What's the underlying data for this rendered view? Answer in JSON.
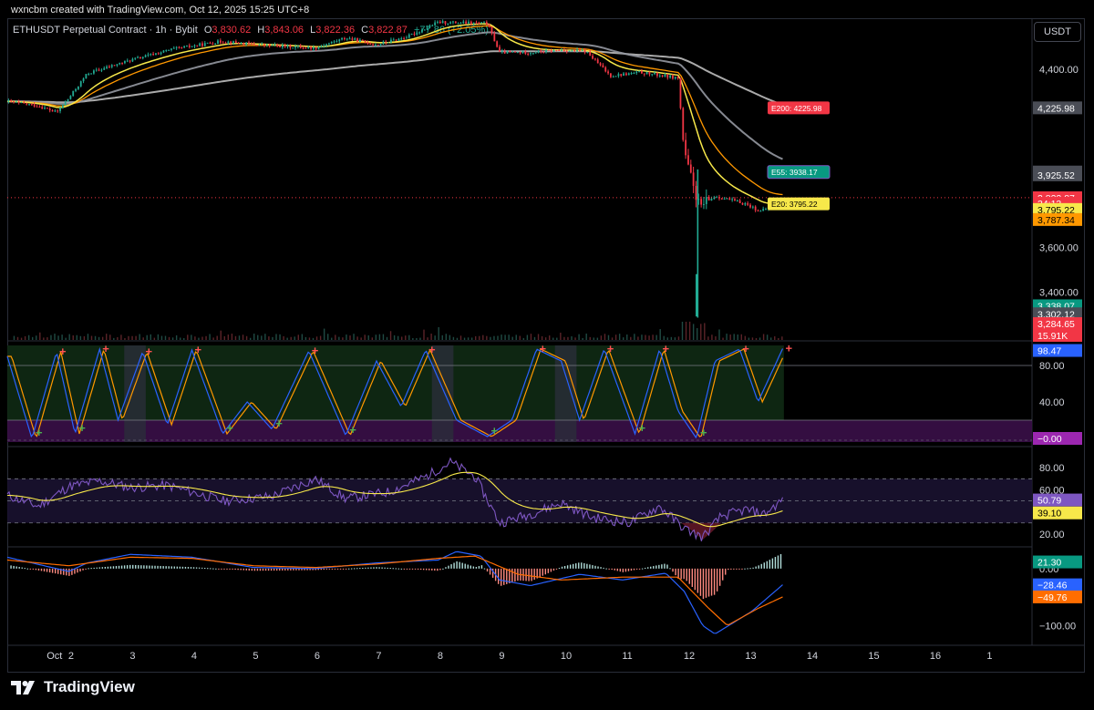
{
  "header": {
    "creator": "wxncbm created with TradingView.com, Oct 12, 2025 15:25 UTC+8"
  },
  "symbol": {
    "title": "ETHUSDT Perpetual Contract · 1h · Bybit",
    "o_label": "O",
    "o": "3,830.62",
    "h_label": "H",
    "h": "3,843.06",
    "l_label": "L",
    "l": "3,822.36",
    "c_label": "C",
    "c": "3,822.87",
    "change": "+77.86 (+2.05%)"
  },
  "currency_button": "USDT",
  "brand": {
    "name": "TradingView",
    "icon": "tradingview-logo-icon"
  },
  "colors": {
    "up": "#22ab94",
    "down": "#f23645",
    "ema20": "#f7e84a",
    "ema55": "#9598a1",
    "ema200": "#c8c8c8",
    "stoch_k": "#2962ff",
    "stoch_d": "#ff9800",
    "rsi": "#7e57c2",
    "rsi_ma": "#f7e84a",
    "macd": "#2962ff",
    "signal": "#ff6d00"
  },
  "chart_data": [
    {
      "type": "candlestick",
      "title": "ETHUSDT Perpetual Contract · 1h · Bybit",
      "x_ticks": [
        "Oct",
        "2",
        "3",
        "4",
        "5",
        "6",
        "7",
        "8",
        "9",
        "10",
        "11",
        "12",
        "13",
        "14",
        "15",
        "16",
        "1"
      ],
      "y_ticks": [
        "4,400.00",
        "3,600.00",
        "3,400.00"
      ],
      "ylim": [
        3250,
        4620
      ],
      "path_approx": [
        {
          "x": 0.0,
          "y": 4255
        },
        {
          "x": 0.5,
          "y": 4235
        },
        {
          "x": 0.8,
          "y": 4205
        },
        {
          "x": 1.0,
          "y": 4270
        },
        {
          "x": 1.3,
          "y": 4380
        },
        {
          "x": 2.0,
          "y": 4440
        },
        {
          "x": 2.7,
          "y": 4490
        },
        {
          "x": 3.5,
          "y": 4525
        },
        {
          "x": 4.0,
          "y": 4510
        },
        {
          "x": 5.0,
          "y": 4495
        },
        {
          "x": 5.5,
          "y": 4540
        },
        {
          "x": 6.0,
          "y": 4510
        },
        {
          "x": 6.5,
          "y": 4545
        },
        {
          "x": 7.0,
          "y": 4610
        },
        {
          "x": 7.8,
          "y": 4605
        },
        {
          "x": 8.0,
          "y": 4475
        },
        {
          "x": 8.5,
          "y": 4475
        },
        {
          "x": 9.0,
          "y": 4485
        },
        {
          "x": 9.4,
          "y": 4480
        },
        {
          "x": 9.8,
          "y": 4370
        },
        {
          "x": 10.3,
          "y": 4385
        },
        {
          "x": 10.9,
          "y": 4360
        },
        {
          "x": 11.0,
          "y": 4020
        },
        {
          "x": 11.25,
          "y": 3780
        },
        {
          "x": 11.5,
          "y": 3830
        },
        {
          "x": 12.0,
          "y": 3795
        },
        {
          "x": 12.25,
          "y": 3760
        },
        {
          "x": 12.6,
          "y": 3822.87
        }
      ],
      "flash_wick_low": 3284.65,
      "labels": {
        "ema200": {
          "text": "E200: 4225.98",
          "value": 4225.98
        },
        "ema55": {
          "text": "E55: 3938.17",
          "value": 3938.17
        },
        "ema20": {
          "text": "E20: 3795.22",
          "value": 3795.22
        }
      },
      "price_scale_labels": [
        {
          "text": "4,225.98",
          "value": 4225.98,
          "bg": "#4a4d56"
        },
        {
          "text": "3,938.17",
          "value": 3938.17,
          "bg": "#4a4d56"
        },
        {
          "text": "3,925.52",
          "value": 3925.52,
          "bg": "#4a4d56"
        },
        {
          "text": "3,822.87",
          "value": 3822.87,
          "bg": "#f23645"
        },
        {
          "text": "34:13",
          "value": 3798,
          "bg": "#f23645"
        },
        {
          "text": "3,795.22",
          "value": 3770,
          "bg": "#f7e84a",
          "fg": "#000"
        },
        {
          "text": "3,787.34",
          "value": 3725,
          "bg": "#ff9800",
          "fg": "#000"
        },
        {
          "text": "3,338.07",
          "value": 3338.07,
          "bg": "#089981"
        },
        {
          "text": "3,302.12",
          "value": 3302.12,
          "bg": "#4a4d56"
        },
        {
          "text": "3,284.65",
          "value": 3258,
          "bg": "#f23645"
        }
      ],
      "volume_label": "15.91K"
    },
    {
      "type": "line",
      "name": "Stochastic RSI",
      "y_ticks": [
        "80.00",
        "40.00"
      ],
      "ylim": [
        0,
        100
      ],
      "bands": [
        80,
        20
      ],
      "series": [
        {
          "name": "K",
          "cycles_approx": [
            {
              "x": 0.0,
              "v": 90
            },
            {
              "x": 0.4,
              "v": 0
            },
            {
              "x": 0.8,
              "v": 95
            },
            {
              "x": 1.1,
              "v": 5
            },
            {
              "x": 1.5,
              "v": 98
            },
            {
              "x": 1.8,
              "v": 20
            },
            {
              "x": 2.2,
              "v": 95
            },
            {
              "x": 2.6,
              "v": 15
            },
            {
              "x": 3.0,
              "v": 97
            },
            {
              "x": 3.5,
              "v": 5
            },
            {
              "x": 3.9,
              "v": 40
            },
            {
              "x": 4.3,
              "v": 10
            },
            {
              "x": 4.9,
              "v": 96
            },
            {
              "x": 5.5,
              "v": 3
            },
            {
              "x": 6.0,
              "v": 85
            },
            {
              "x": 6.4,
              "v": 35
            },
            {
              "x": 6.8,
              "v": 97
            },
            {
              "x": 7.3,
              "v": 20
            },
            {
              "x": 7.8,
              "v": 2
            },
            {
              "x": 8.2,
              "v": 20
            },
            {
              "x": 8.6,
              "v": 98
            },
            {
              "x": 9.0,
              "v": 85
            },
            {
              "x": 9.3,
              "v": 20
            },
            {
              "x": 9.7,
              "v": 98
            },
            {
              "x": 10.2,
              "v": 5
            },
            {
              "x": 10.6,
              "v": 98
            },
            {
              "x": 10.9,
              "v": 30
            },
            {
              "x": 11.2,
              "v": 0
            },
            {
              "x": 11.5,
              "v": 85
            },
            {
              "x": 11.9,
              "v": 98
            },
            {
              "x": 12.2,
              "v": 40
            },
            {
              "x": 12.6,
              "v": 98.47
            }
          ]
        }
      ],
      "value_labels": [
        {
          "text": "98.47",
          "value": 98.47,
          "bg": "#2962ff"
        },
        {
          "text": "−0.00",
          "value": 0,
          "bg": "#9c27b0"
        }
      ]
    },
    {
      "type": "line",
      "name": "RSI",
      "y_ticks": [
        "80.00",
        "60.00",
        "20.00"
      ],
      "ylim": [
        10,
        95
      ],
      "bands": [
        70,
        50,
        30
      ],
      "series": [
        {
          "name": "RSI",
          "last": 50.79,
          "path_approx": [
            {
              "x": 0,
              "v": 55
            },
            {
              "x": 0.5,
              "v": 45
            },
            {
              "x": 1,
              "v": 63
            },
            {
              "x": 1.5,
              "v": 68
            },
            {
              "x": 2,
              "v": 62
            },
            {
              "x": 2.6,
              "v": 64
            },
            {
              "x": 3,
              "v": 58
            },
            {
              "x": 3.5,
              "v": 50
            },
            {
              "x": 4.3,
              "v": 54
            },
            {
              "x": 5.0,
              "v": 70
            },
            {
              "x": 5.5,
              "v": 52
            },
            {
              "x": 6.2,
              "v": 58
            },
            {
              "x": 6.8,
              "v": 72
            },
            {
              "x": 7.2,
              "v": 85
            },
            {
              "x": 7.6,
              "v": 72
            },
            {
              "x": 8.0,
              "v": 30
            },
            {
              "x": 8.5,
              "v": 38
            },
            {
              "x": 9.0,
              "v": 48
            },
            {
              "x": 9.5,
              "v": 35
            },
            {
              "x": 10.1,
              "v": 30
            },
            {
              "x": 10.6,
              "v": 45
            },
            {
              "x": 11.0,
              "v": 25
            },
            {
              "x": 11.3,
              "v": 17
            },
            {
              "x": 11.6,
              "v": 36
            },
            {
              "x": 12.0,
              "v": 42
            },
            {
              "x": 12.3,
              "v": 38
            },
            {
              "x": 12.6,
              "v": 50.79
            }
          ]
        },
        {
          "name": "RSI MA",
          "last": 39.1
        }
      ],
      "value_labels": [
        {
          "text": "50.79",
          "value": 50.79,
          "bg": "#7e57c2"
        },
        {
          "text": "39.10",
          "value": 39.1,
          "bg": "#f7e84a",
          "fg": "#000"
        }
      ]
    },
    {
      "type": "bar",
      "name": "MACD",
      "y_ticks": [
        "0.00",
        "−100.00"
      ],
      "ylim": [
        -130,
        35
      ],
      "macd_path_approx": [
        {
          "x": 0,
          "v": 20
        },
        {
          "x": 1,
          "v": -5
        },
        {
          "x": 1.3,
          "v": 10
        },
        {
          "x": 2,
          "v": 25
        },
        {
          "x": 3,
          "v": 20
        },
        {
          "x": 4,
          "v": 2
        },
        {
          "x": 5,
          "v": 0
        },
        {
          "x": 6,
          "v": 10
        },
        {
          "x": 7,
          "v": 15
        },
        {
          "x": 7.3,
          "v": 30
        },
        {
          "x": 7.7,
          "v": 22
        },
        {
          "x": 8.0,
          "v": -20
        },
        {
          "x": 8.5,
          "v": -30
        },
        {
          "x": 9.3,
          "v": -10
        },
        {
          "x": 10,
          "v": -20
        },
        {
          "x": 10.7,
          "v": -8
        },
        {
          "x": 11.0,
          "v": -40
        },
        {
          "x": 11.3,
          "v": -100
        },
        {
          "x": 11.5,
          "v": -115
        },
        {
          "x": 12.1,
          "v": -75
        },
        {
          "x": 12.6,
          "v": -28.46
        }
      ],
      "signal_path_approx": [
        {
          "x": 0,
          "v": 15
        },
        {
          "x": 1,
          "v": 5
        },
        {
          "x": 2,
          "v": 20
        },
        {
          "x": 3,
          "v": 18
        },
        {
          "x": 4,
          "v": 5
        },
        {
          "x": 5,
          "v": 2
        },
        {
          "x": 6,
          "v": 8
        },
        {
          "x": 7,
          "v": 18
        },
        {
          "x": 7.6,
          "v": 22
        },
        {
          "x": 8.3,
          "v": -10
        },
        {
          "x": 9,
          "v": -20
        },
        {
          "x": 10,
          "v": -15
        },
        {
          "x": 10.9,
          "v": -15
        },
        {
          "x": 11.4,
          "v": -70
        },
        {
          "x": 11.7,
          "v": -100
        },
        {
          "x": 12.2,
          "v": -70
        },
        {
          "x": 12.6,
          "v": -49.76
        }
      ],
      "value_labels": [
        {
          "text": "21.30",
          "value": 21.3,
          "bg": "#089981"
        },
        {
          "text": "−28.46",
          "value": -28.46,
          "bg": "#2962ff"
        },
        {
          "text": "−49.76",
          "value": -49.76,
          "bg": "#ff6d00"
        }
      ]
    }
  ]
}
